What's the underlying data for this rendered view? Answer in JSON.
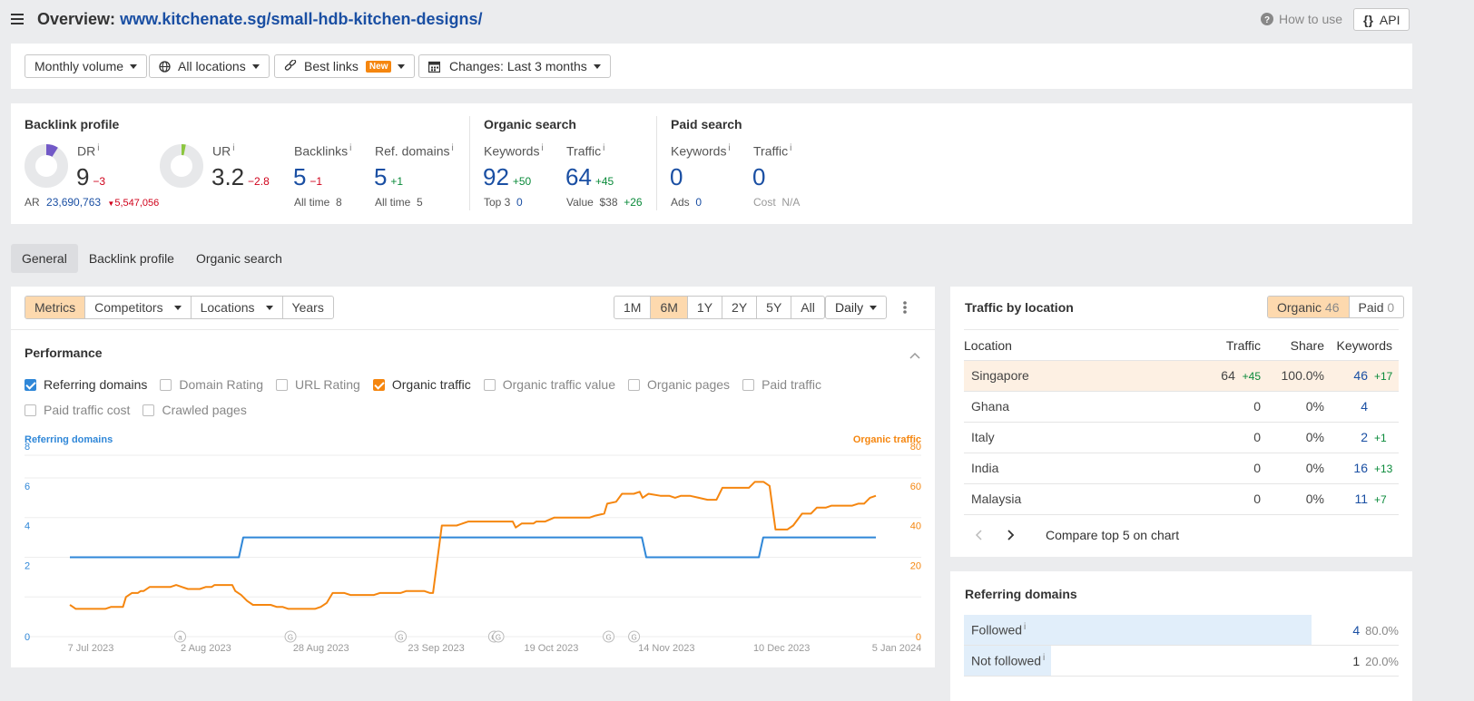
{
  "header": {
    "menu_icon": "hamburger-icon",
    "title_prefix": "Overview:",
    "url": "www.kitchenate.sg/small-hdb-kitchen-designs/",
    "how_to_use": "How to use",
    "api_label": "API"
  },
  "filters": {
    "volume": "Monthly volume",
    "locations": "All locations",
    "best_links": "Best links",
    "best_links_badge": "New",
    "changes": "Changes: Last 3 months"
  },
  "summary": {
    "backlink_profile": {
      "title": "Backlink profile",
      "dr": {
        "label": "DR",
        "value": "9",
        "delta": "−3",
        "gauge_fraction": 0.09
      },
      "ur": {
        "label": "UR",
        "value": "3.2",
        "delta": "−2.8",
        "gauge_fraction": 0.032
      },
      "ar": {
        "label": "AR",
        "value": "23,690,763",
        "delta": "5,547,056"
      },
      "backlinks": {
        "label": "Backlinks",
        "value": "5",
        "delta": "−1",
        "sub_label": "All time",
        "sub_value": "8"
      },
      "ref_domains": {
        "label": "Ref. domains",
        "value": "5",
        "delta": "+1",
        "sub_label": "All time",
        "sub_value": "5"
      }
    },
    "organic_search": {
      "title": "Organic search",
      "keywords": {
        "label": "Keywords",
        "value": "92",
        "delta": "+50",
        "sub_label": "Top 3",
        "sub_value": "0"
      },
      "traffic": {
        "label": "Traffic",
        "value": "64",
        "delta": "+45",
        "sub_label": "Value",
        "sub_value": "$38",
        "sub_delta": "+26"
      }
    },
    "paid_search": {
      "title": "Paid search",
      "keywords": {
        "label": "Keywords",
        "value": "0",
        "sub_label": "Ads",
        "sub_value": "0"
      },
      "traffic": {
        "label": "Traffic",
        "value": "0",
        "sub_label": "Cost",
        "sub_value": "N/A"
      }
    }
  },
  "tabs": [
    {
      "label": "General",
      "active": true
    },
    {
      "label": "Backlink profile",
      "active": false
    },
    {
      "label": "Organic search",
      "active": false
    }
  ],
  "chart_panel": {
    "view_buttons": [
      "Metrics",
      "Competitors",
      "Locations",
      "Years"
    ],
    "range_buttons": [
      "1M",
      "6M",
      "1Y",
      "2Y",
      "5Y",
      "All"
    ],
    "active_range": "6M",
    "interval": "Daily",
    "section_title": "Performance",
    "metrics": [
      {
        "label": "Referring domains",
        "checked": true,
        "color": "#2f87d8"
      },
      {
        "label": "Domain Rating",
        "checked": false
      },
      {
        "label": "URL Rating",
        "checked": false
      },
      {
        "label": "Organic traffic",
        "checked": true,
        "color": "#f5860f"
      },
      {
        "label": "Organic traffic value",
        "checked": false
      },
      {
        "label": "Organic pages",
        "checked": false
      },
      {
        "label": "Paid traffic",
        "checked": false
      },
      {
        "label": "Paid traffic cost",
        "checked": false
      },
      {
        "label": "Crawled pages",
        "checked": false
      }
    ]
  },
  "chart_data": {
    "type": "line",
    "title": "Performance",
    "x_tick_labels": [
      "7 Jul 2023",
      "2 Aug 2023",
      "28 Aug 2023",
      "23 Sep 2023",
      "19 Oct 2023",
      "14 Nov 2023",
      "10 Dec 2023",
      "5 Jan 2024"
    ],
    "left_axis": {
      "label": "Referring domains",
      "ticks": [
        "0",
        "2",
        "4",
        "6",
        "8"
      ],
      "range": [
        0,
        8
      ],
      "color": "#2f87d8"
    },
    "right_axis": {
      "label": "Organic traffic",
      "ticks": [
        "0",
        "20",
        "40",
        "60",
        "80"
      ],
      "range": [
        0,
        80
      ],
      "color": "#f5860f"
    },
    "grid": true,
    "annotations": [
      {
        "label": "a",
        "day": 26
      },
      {
        "label": "G",
        "day": 52
      },
      {
        "label": "G",
        "day": 78
      },
      {
        "label": "G",
        "day": 100
      },
      {
        "label": "G",
        "day": 101
      },
      {
        "label": "G",
        "day": 127
      },
      {
        "label": "G",
        "day": 133
      }
    ],
    "x_range_days": [
      0,
      190
    ],
    "series": [
      {
        "name": "Referring domains",
        "axis": "left",
        "points": [
          [
            0,
            4
          ],
          [
            39,
            4
          ],
          [
            40,
            5
          ],
          [
            132,
            5
          ],
          [
            133,
            4
          ],
          [
            159,
            4
          ],
          [
            160,
            5
          ],
          [
            186,
            5
          ]
        ]
      },
      {
        "name": "Organic traffic",
        "axis": "right",
        "points": [
          [
            0,
            16
          ],
          [
            1,
            15
          ],
          [
            2,
            14
          ],
          [
            12,
            14
          ],
          [
            14,
            15
          ],
          [
            18,
            15
          ],
          [
            19,
            20
          ],
          [
            21,
            22
          ],
          [
            23,
            22
          ],
          [
            24,
            23
          ],
          [
            25,
            23
          ],
          [
            27,
            25
          ],
          [
            34,
            25
          ],
          [
            36,
            26
          ],
          [
            38,
            25
          ],
          [
            40,
            24
          ],
          [
            44,
            24
          ],
          [
            46,
            25
          ],
          [
            48,
            25
          ],
          [
            49,
            26
          ],
          [
            55,
            26
          ],
          [
            56,
            23
          ],
          [
            58,
            21
          ],
          [
            60,
            18
          ],
          [
            62,
            16
          ],
          [
            68,
            16
          ],
          [
            70,
            15
          ],
          [
            72,
            15
          ],
          [
            74,
            14
          ],
          [
            83,
            14
          ],
          [
            85,
            15
          ],
          [
            87,
            17
          ],
          [
            89,
            22
          ],
          [
            93,
            22
          ],
          [
            95,
            21
          ],
          [
            103,
            21
          ],
          [
            105,
            22
          ],
          [
            112,
            22
          ],
          [
            114,
            23
          ],
          [
            120,
            23
          ],
          [
            122,
            22
          ],
          [
            123,
            22
          ],
          [
            126,
            56
          ],
          [
            131,
            56
          ],
          [
            135,
            58
          ],
          [
            150,
            58
          ],
          [
            151,
            55
          ],
          [
            153,
            57
          ],
          [
            157,
            57
          ],
          [
            158,
            58
          ],
          [
            161,
            58
          ],
          [
            164,
            60
          ],
          [
            176,
            60
          ],
          [
            178,
            61
          ],
          [
            181,
            62
          ],
          [
            182,
            67
          ],
          [
            185,
            68
          ],
          [
            187,
            72
          ],
          [
            191,
            72
          ],
          [
            193,
            73
          ],
          [
            194,
            70
          ],
          [
            196,
            72
          ],
          [
            200,
            71
          ],
          [
            203,
            71
          ],
          [
            205,
            70
          ],
          [
            207,
            71
          ],
          [
            210,
            71
          ],
          [
            213,
            70
          ],
          [
            216,
            69
          ],
          [
            219,
            69
          ],
          [
            221,
            75
          ],
          [
            226,
            75
          ],
          [
            230,
            75
          ],
          [
            232,
            78
          ],
          [
            235,
            78
          ],
          [
            237,
            76
          ],
          [
            239,
            54
          ],
          [
            243,
            54
          ],
          [
            245,
            56
          ],
          [
            248,
            62
          ],
          [
            251,
            62
          ],
          [
            253,
            65
          ],
          [
            256,
            65
          ],
          [
            258,
            66
          ],
          [
            265,
            66
          ],
          [
            267,
            67
          ],
          [
            269,
            67
          ],
          [
            271,
            70
          ],
          [
            273,
            71
          ]
        ]
      }
    ]
  },
  "traffic_by_location": {
    "title": "Traffic by location",
    "toggle": [
      {
        "label": "Organic",
        "count": "46",
        "active": true
      },
      {
        "label": "Paid",
        "count": "0",
        "active": false
      }
    ],
    "columns": [
      "Location",
      "Traffic",
      "Share",
      "Keywords"
    ],
    "rows": [
      {
        "location": "Singapore",
        "traffic": "64",
        "traffic_delta": "+45",
        "share": "100.0%",
        "keywords": "46",
        "keywords_delta": "+17",
        "highlight": true
      },
      {
        "location": "Ghana",
        "traffic": "0",
        "traffic_delta": "",
        "share": "0%",
        "keywords": "4",
        "keywords_delta": ""
      },
      {
        "location": "Italy",
        "traffic": "0",
        "traffic_delta": "",
        "share": "0%",
        "keywords": "2",
        "keywords_delta": "+1"
      },
      {
        "location": "India",
        "traffic": "0",
        "traffic_delta": "",
        "share": "0%",
        "keywords": "16",
        "keywords_delta": "+13"
      },
      {
        "location": "Malaysia",
        "traffic": "0",
        "traffic_delta": "",
        "share": "0%",
        "keywords": "11",
        "keywords_delta": "+7"
      }
    ],
    "compare_label": "Compare top 5 on chart"
  },
  "referring_domains": {
    "title": "Referring domains",
    "rows": [
      {
        "label": "Followed",
        "count": "4",
        "percent": "80.0%",
        "fraction": 0.8
      },
      {
        "label": "Not followed",
        "count": "1",
        "percent": "20.0%",
        "fraction": 0.2
      }
    ]
  }
}
